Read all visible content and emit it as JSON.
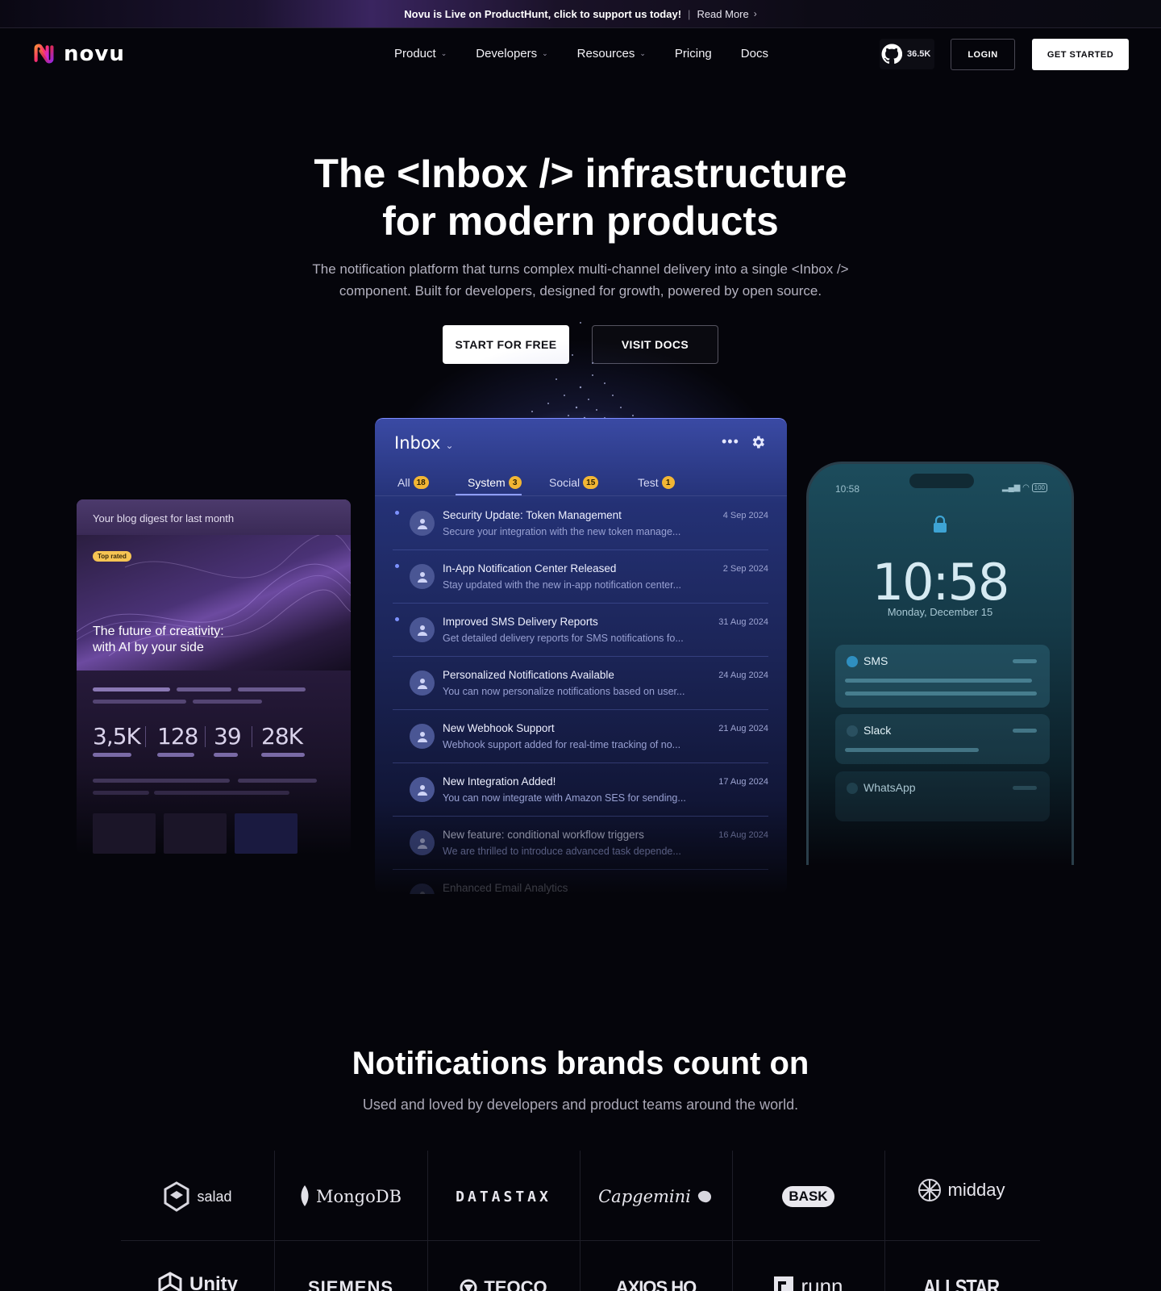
{
  "announcement": {
    "message": "Novu is Live on ProductHunt, click to support us today!",
    "separator": "|",
    "link": "Read More",
    "chevron": "›"
  },
  "brand": {
    "name": "novu",
    "accent": "#ff2e6c"
  },
  "nav": {
    "items": [
      {
        "label": "Product",
        "has_caret": true
      },
      {
        "label": "Developers",
        "has_caret": true
      },
      {
        "label": "Resources",
        "has_caret": true
      },
      {
        "label": "Pricing",
        "has_caret": false
      },
      {
        "label": "Docs",
        "has_caret": false
      }
    ],
    "caret": "⌄",
    "github_stars": "36.5K",
    "login": "LOGIN",
    "get_started": "GET STARTED"
  },
  "hero": {
    "title_line1": "The <Inbox /> infrastructure",
    "title_line2": "for modern products",
    "subtitle_line1": "The notification platform that turns complex multi-channel delivery into a single <Inbox />",
    "subtitle_line2": "component. Built for developers, designed for growth, powered by open source.",
    "cta_primary": "START FOR FREE",
    "cta_secondary": "VISIT DOCS"
  },
  "blog_card": {
    "header": "Your blog digest for last month",
    "badge": "Top rated",
    "image_title_line1": "The future of creativity:",
    "image_title_line2": "with AI by your side",
    "stats": [
      "3,5K",
      "128",
      "39",
      "28K"
    ]
  },
  "inbox": {
    "title": "Inbox",
    "caret": "⌄",
    "more": "•••",
    "tabs": [
      {
        "label": "All",
        "count": "18"
      },
      {
        "label": "System",
        "count": "3"
      },
      {
        "label": "Social",
        "count": "15"
      },
      {
        "label": "Test",
        "count": "1"
      }
    ],
    "active_tab": "System",
    "notifications": [
      {
        "title": "Security Update: Token Management",
        "date": "4 Sep 2024",
        "snippet": "Secure your integration with the new token manage...",
        "unread": true
      },
      {
        "title": "In-App Notification Center Released",
        "date": "2 Sep 2024",
        "snippet": "Stay updated with the new in-app notification center...",
        "unread": true
      },
      {
        "title": "Improved SMS Delivery Reports",
        "date": "31 Aug 2024",
        "snippet": "Get detailed delivery reports for SMS notifications fo...",
        "unread": true
      },
      {
        "title": "Personalized Notifications Available",
        "date": "24 Aug 2024",
        "snippet": "You can now personalize notifications based on user...",
        "unread": false
      },
      {
        "title": "New Webhook Support",
        "date": "21 Aug 2024",
        "snippet": "Webhook support added for real-time tracking of no...",
        "unread": false
      },
      {
        "title": "New Integration Added!",
        "date": "17 Aug 2024",
        "snippet": "You can now integrate with Amazon SES for sending...",
        "unread": false
      },
      {
        "title": "New feature: conditional workflow triggers",
        "date": "16 Aug 2024",
        "snippet": "We are thrilled to introduce advanced task depende...",
        "unread": false
      },
      {
        "title": "Enhanced Email Analytics",
        "date": "",
        "snippet": "",
        "unread": false
      }
    ]
  },
  "phone": {
    "status_time": "10:58",
    "status_battery": "100",
    "clock": "10:58",
    "date": "Monday, December 15",
    "notifications": [
      "SMS",
      "Slack",
      "WhatsApp"
    ]
  },
  "brands": {
    "title": "Notifications brands count on",
    "subtitle": "Used and loved by developers and product teams around the world.",
    "row1": [
      "salad",
      "MongoDB",
      "DATASTAX",
      "Capgemini",
      "BASK",
      "midday"
    ],
    "row2": [
      "Unity",
      "SIEMENS",
      "TEOCO",
      "AXIOS HQ",
      "runn",
      "ALLSTAR"
    ]
  }
}
